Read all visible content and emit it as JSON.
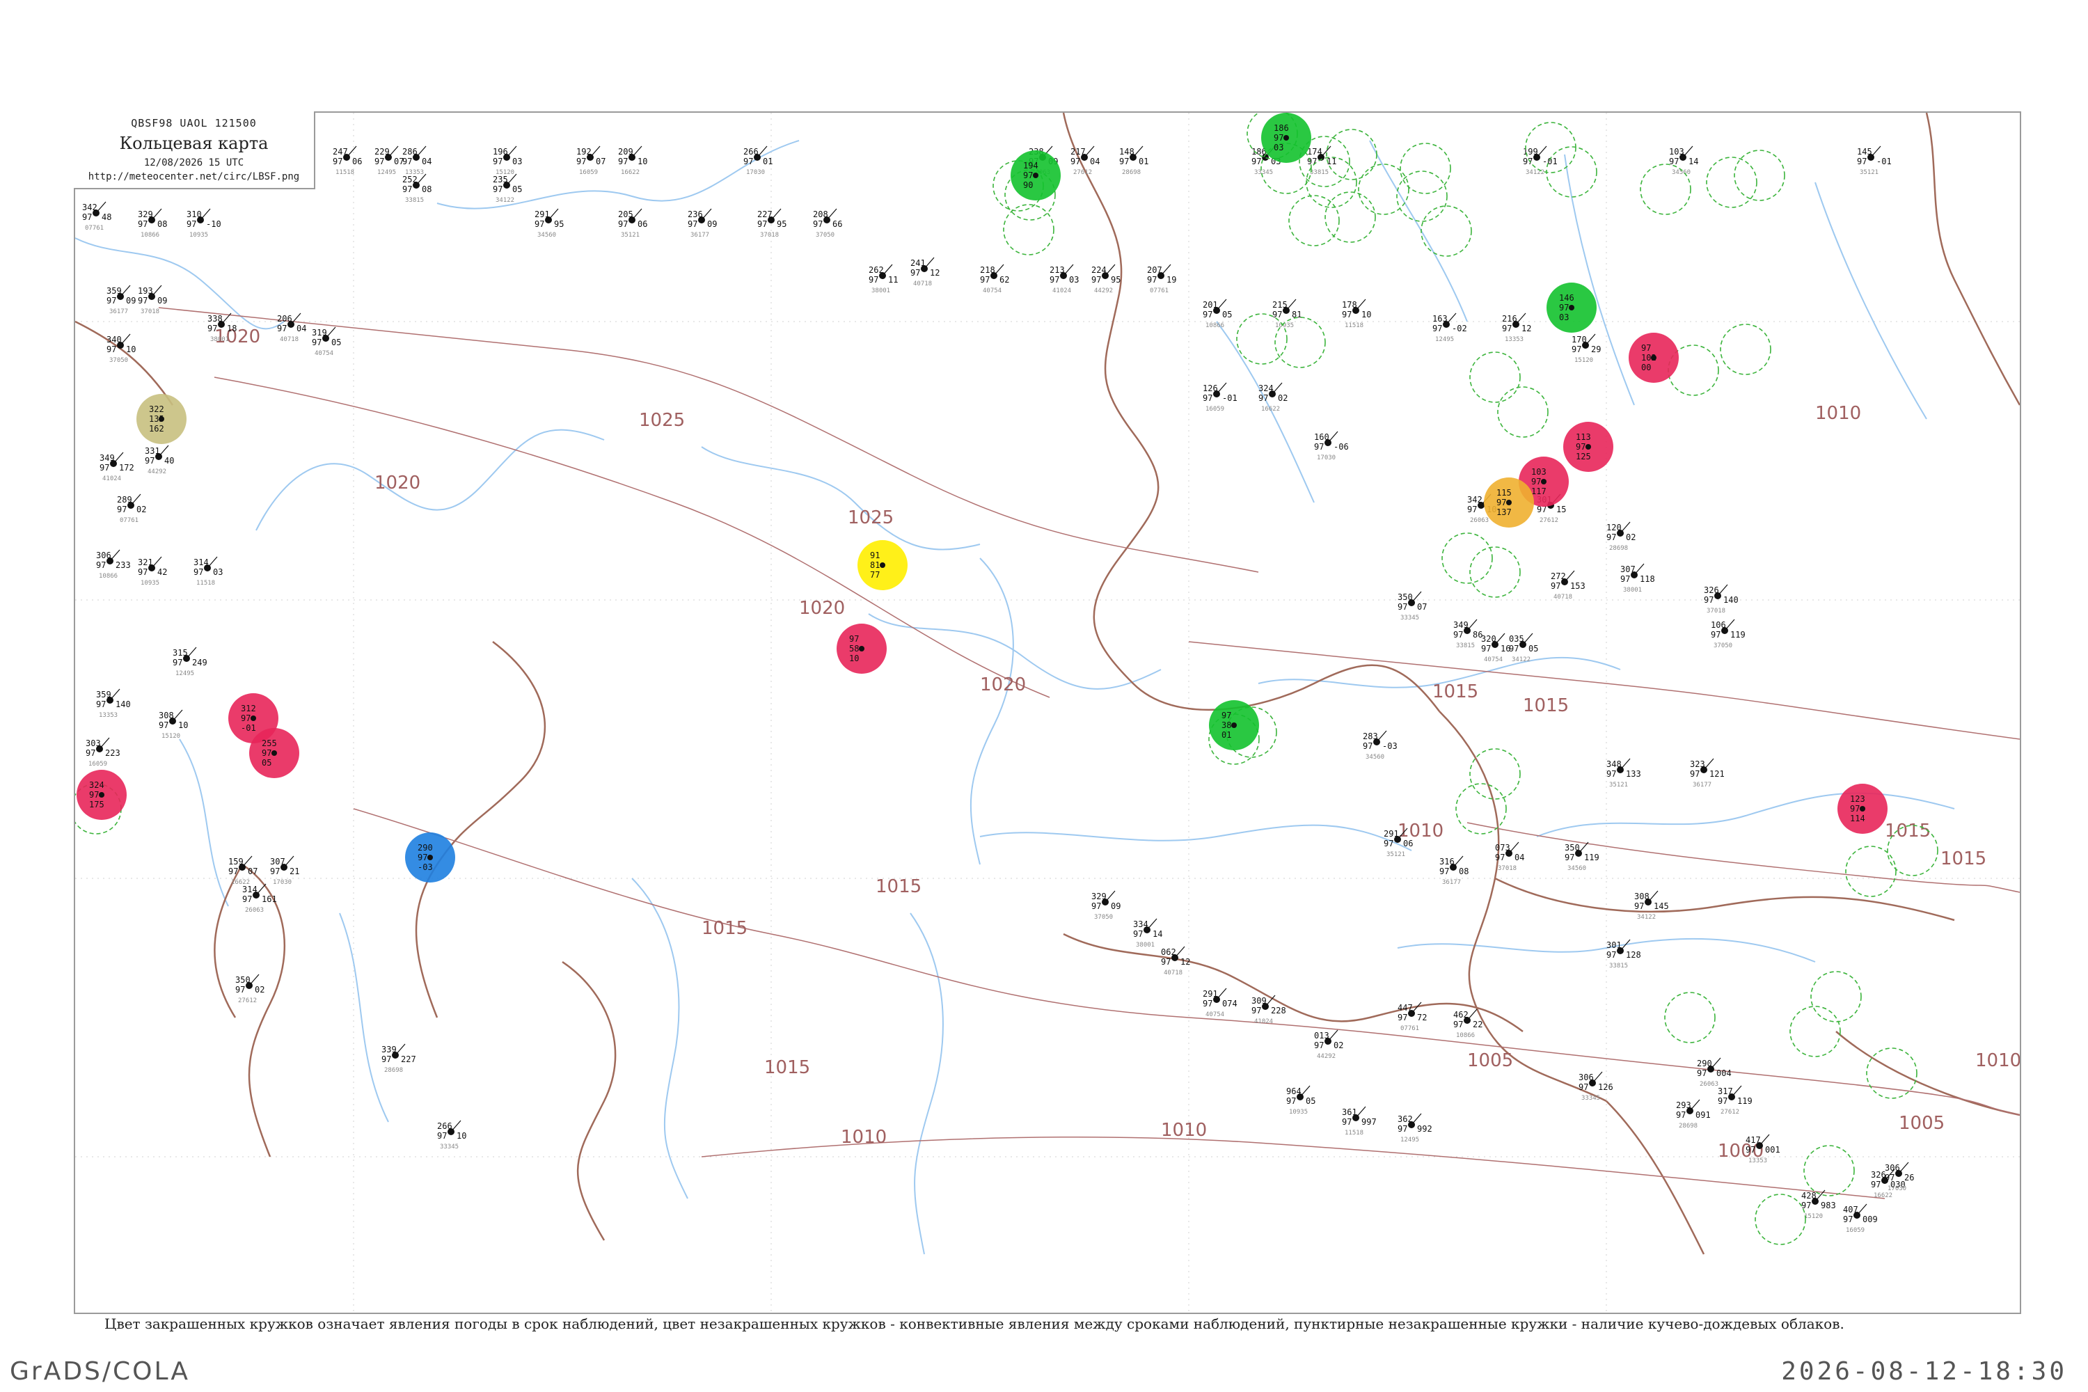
{
  "header": {
    "code": "QBSF98  UAOL  121500",
    "title": "Кольцевая карта",
    "date": "12/08/2026 15 UTC",
    "url": "http://meteocenter.net/circ/LBSF.png"
  },
  "legend_note": "Цвет закрашенных кружков означает явления погоды в срок наблюдений, цвет незакрашенных кружков - конвективные явления между сроками наблюдений, пунктирные незакрашенные кружки - наличие кучево-дождевых облаков.",
  "footer": {
    "left": "GrADS/COLA",
    "right": "2026-08-12-18:30"
  },
  "colors": {
    "frame": "#9a9a9a",
    "rivers": "#9ec9f0",
    "borders": "#a06a5a",
    "isobars": "#b07070",
    "thunderstorm": "#e8265a",
    "rain": "#13c22e",
    "fog": "#ffee00",
    "showers": "#1e7fe0",
    "dust": "#f0b030",
    "haze": "#c8c080",
    "cb_dashed": "#3cb43c"
  },
  "isobar_labels": [
    "1020",
    "1025",
    "1020",
    "1025",
    "1020",
    "1020",
    "1015",
    "1015",
    "1010",
    "1015",
    "1015",
    "1015",
    "1010",
    "1010",
    "1005",
    "1010",
    "1005",
    "1000",
    "1010",
    "1015",
    "1015"
  ],
  "weather_stations": [
    {
      "name": "st-01",
      "color": "thunderstorm",
      "pressure": "324",
      "temp": "97",
      "dew": "175"
    },
    {
      "name": "st-02",
      "color": "haze",
      "pressure": "322",
      "temp": "135",
      "dew": "162"
    },
    {
      "name": "st-03",
      "color": "thunderstorm",
      "pressure": "312",
      "temp": "97",
      "dew": "-01"
    },
    {
      "name": "st-04",
      "color": "thunderstorm",
      "pressure": "255",
      "temp": "97",
      "dew": "05"
    },
    {
      "name": "st-05",
      "color": "showers",
      "pressure": "290",
      "temp": "97",
      "dew": "-03"
    },
    {
      "name": "st-06",
      "color": "fog",
      "pressure": "91",
      "temp": "81",
      "dew": "77"
    },
    {
      "name": "st-07",
      "color": "thunderstorm",
      "pressure": "97",
      "temp": "58",
      "dew": "10"
    },
    {
      "name": "st-08",
      "color": "rain",
      "pressure": "194",
      "temp": "97",
      "dew": "90"
    },
    {
      "name": "st-09",
      "color": "rain",
      "pressure": "97",
      "temp": "38",
      "dew": "01"
    },
    {
      "name": "st-10",
      "color": "rain",
      "pressure": "186",
      "temp": "97",
      "dew": "03"
    },
    {
      "name": "st-11",
      "color": "thunderstorm",
      "pressure": "123",
      "temp": "97",
      "dew": "114"
    },
    {
      "name": "st-12",
      "color": "thunderstorm",
      "pressure": "97",
      "temp": "102",
      "dew": "00"
    },
    {
      "name": "st-13",
      "color": "thunderstorm",
      "pressure": "113",
      "temp": "97",
      "dew": "125"
    },
    {
      "name": "st-14",
      "color": "thunderstorm",
      "pressure": "103",
      "temp": "97",
      "dew": "117"
    },
    {
      "name": "st-15",
      "color": "dust",
      "pressure": "115",
      "temp": "97",
      "dew": "137"
    },
    {
      "name": "st-16",
      "color": "rain",
      "pressure": "146",
      "temp": "97",
      "dew": "03"
    }
  ],
  "station_plots": [
    {
      "p": "342",
      "t": "97",
      "d": "48"
    },
    {
      "p": "329",
      "t": "97",
      "d": "08"
    },
    {
      "p": "310",
      "t": "97",
      "d": "-10"
    },
    {
      "p": "247",
      "t": "97",
      "d": "06"
    },
    {
      "p": "229",
      "t": "97",
      "d": "07"
    },
    {
      "p": "286",
      "t": "97",
      "d": "04"
    },
    {
      "p": "196",
      "t": "97",
      "d": "03"
    },
    {
      "p": "192",
      "t": "97",
      "d": "07"
    },
    {
      "p": "209",
      "t": "97",
      "d": "10"
    },
    {
      "p": "266",
      "t": "97",
      "d": "01"
    },
    {
      "p": "238",
      "t": "97",
      "d": "09"
    },
    {
      "p": "217",
      "t": "97",
      "d": "04"
    },
    {
      "p": "148",
      "t": "97",
      "d": "01"
    },
    {
      "p": "186",
      "t": "97",
      "d": "03"
    },
    {
      "p": "174",
      "t": "97",
      "d": "11"
    },
    {
      "p": "199",
      "t": "97",
      "d": "-01"
    },
    {
      "p": "103",
      "t": "97",
      "d": "14"
    },
    {
      "p": "145",
      "t": "97",
      "d": "-01"
    },
    {
      "p": "359",
      "t": "97",
      "d": "09"
    },
    {
      "p": "193",
      "t": "97",
      "d": "09"
    },
    {
      "p": "340",
      "t": "97",
      "d": "10"
    },
    {
      "p": "338",
      "t": "97",
      "d": "18"
    },
    {
      "p": "206",
      "t": "97",
      "d": "04"
    },
    {
      "p": "319",
      "t": "97",
      "d": "05"
    },
    {
      "p": "349",
      "t": "97",
      "d": "172"
    },
    {
      "p": "331",
      "t": "97",
      "d": "40"
    },
    {
      "p": "289",
      "t": "97",
      "d": "02"
    },
    {
      "p": "306",
      "t": "97",
      "d": "233"
    },
    {
      "p": "321",
      "t": "97",
      "d": "42"
    },
    {
      "p": "314",
      "t": "97",
      "d": "03"
    },
    {
      "p": "315",
      "t": "97",
      "d": "249"
    },
    {
      "p": "359",
      "t": "97",
      "d": "140"
    },
    {
      "p": "308",
      "t": "97",
      "d": "10"
    },
    {
      "p": "303",
      "t": "97",
      "d": "223"
    },
    {
      "p": "159",
      "t": "97",
      "d": "07"
    },
    {
      "p": "307",
      "t": "97",
      "d": "21"
    },
    {
      "p": "314",
      "t": "97",
      "d": "161"
    },
    {
      "p": "350",
      "t": "97",
      "d": "02"
    },
    {
      "p": "339",
      "t": "97",
      "d": "227"
    },
    {
      "p": "266",
      "t": "97",
      "d": "10"
    },
    {
      "p": "252",
      "t": "97",
      "d": "08"
    },
    {
      "p": "235",
      "t": "97",
      "d": "05"
    },
    {
      "p": "291",
      "t": "97",
      "d": "95"
    },
    {
      "p": "205",
      "t": "97",
      "d": "06"
    },
    {
      "p": "236",
      "t": "97",
      "d": "09"
    },
    {
      "p": "227",
      "t": "97",
      "d": "95"
    },
    {
      "p": "208",
      "t": "97",
      "d": "66"
    },
    {
      "p": "262",
      "t": "97",
      "d": "11"
    },
    {
      "p": "241",
      "t": "97",
      "d": "12"
    },
    {
      "p": "218",
      "t": "97",
      "d": "62"
    },
    {
      "p": "213",
      "t": "97",
      "d": "03"
    },
    {
      "p": "224",
      "t": "97",
      "d": "95"
    },
    {
      "p": "207",
      "t": "97",
      "d": "19"
    },
    {
      "p": "201",
      "t": "97",
      "d": "05"
    },
    {
      "p": "215",
      "t": "97",
      "d": "81"
    },
    {
      "p": "178",
      "t": "97",
      "d": "10"
    },
    {
      "p": "163",
      "t": "97",
      "d": "-02"
    },
    {
      "p": "216",
      "t": "97",
      "d": "12"
    },
    {
      "p": "170",
      "t": "97",
      "d": "29"
    },
    {
      "p": "126",
      "t": "97",
      "d": "-01"
    },
    {
      "p": "324",
      "t": "97",
      "d": "02"
    },
    {
      "p": "160",
      "t": "97",
      "d": "-06"
    },
    {
      "p": "342",
      "t": "97",
      "d": "10"
    },
    {
      "p": "301",
      "t": "97",
      "d": "15"
    },
    {
      "p": "120",
      "t": "97",
      "d": "02"
    },
    {
      "p": "350",
      "t": "97",
      "d": "07"
    },
    {
      "p": "349",
      "t": "97",
      "d": "86"
    },
    {
      "p": "035",
      "t": "97",
      "d": "05"
    },
    {
      "p": "283",
      "t": "97",
      "d": "-03"
    },
    {
      "p": "291",
      "t": "97",
      "d": "06"
    },
    {
      "p": "316",
      "t": "97",
      "d": "08"
    },
    {
      "p": "073",
      "t": "97",
      "d": "04"
    },
    {
      "p": "329",
      "t": "97",
      "d": "09"
    },
    {
      "p": "334",
      "t": "97",
      "d": "14"
    },
    {
      "p": "062",
      "t": "97",
      "d": "12"
    },
    {
      "p": "291",
      "t": "97",
      "d": "074"
    },
    {
      "p": "309",
      "t": "97",
      "d": "228"
    },
    {
      "p": "013",
      "t": "97",
      "d": "02"
    },
    {
      "p": "447",
      "t": "97",
      "d": "72"
    },
    {
      "p": "462",
      "t": "97",
      "d": "22"
    },
    {
      "p": "964",
      "t": "97",
      "d": "05"
    },
    {
      "p": "361",
      "t": "97",
      "d": "997"
    },
    {
      "p": "362",
      "t": "97",
      "d": "992"
    },
    {
      "p": "417",
      "t": "97",
      "d": "001"
    },
    {
      "p": "428",
      "t": "97",
      "d": "983"
    },
    {
      "p": "407",
      "t": "97",
      "d": "009"
    },
    {
      "p": "326",
      "t": "97",
      "d": "030"
    },
    {
      "p": "306",
      "t": "97",
      "d": "26"
    },
    {
      "p": "290",
      "t": "97",
      "d": "004"
    },
    {
      "p": "317",
      "t": "97",
      "d": "119"
    },
    {
      "p": "293",
      "t": "97",
      "d": "091"
    },
    {
      "p": "306",
      "t": "97",
      "d": "126"
    },
    {
      "p": "301",
      "t": "97",
      "d": "128"
    },
    {
      "p": "308",
      "t": "97",
      "d": "145"
    },
    {
      "p": "350",
      "t": "97",
      "d": "119"
    },
    {
      "p": "348",
      "t": "97",
      "d": "133"
    },
    {
      "p": "323",
      "t": "97",
      "d": "121"
    },
    {
      "p": "326",
      "t": "97",
      "d": "140"
    },
    {
      "p": "106",
      "t": "97",
      "d": "119"
    },
    {
      "p": "307",
      "t": "97",
      "d": "118"
    },
    {
      "p": "272",
      "t": "97",
      "d": "153"
    },
    {
      "p": "320",
      "t": "97",
      "d": "16"
    }
  ],
  "station_ids": [
    "07761",
    "10866",
    "10935",
    "11518",
    "12495",
    "13353",
    "15120",
    "16059",
    "16622",
    "17030",
    "26063",
    "27612",
    "28698",
    "33345",
    "33815",
    "34122",
    "34560",
    "35121",
    "36177",
    "37018",
    "37050",
    "38001",
    "40718",
    "40754",
    "41024",
    "44292"
  ]
}
